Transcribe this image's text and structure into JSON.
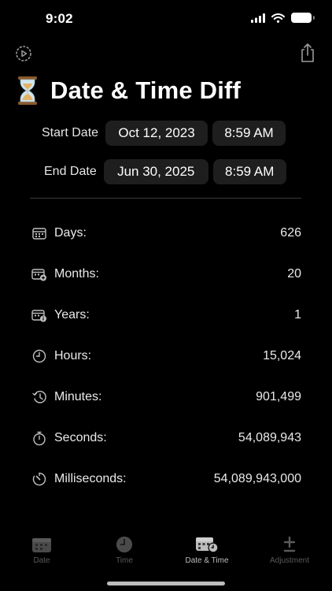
{
  "status_bar": {
    "time": "9:02"
  },
  "header": {
    "title": "Date & Time Diff"
  },
  "start": {
    "label": "Start Date",
    "date": "Oct 12, 2023",
    "time": "8:59 AM"
  },
  "end": {
    "label": "End Date",
    "date": "Jun 30, 2025",
    "time": "8:59 AM"
  },
  "results": [
    {
      "label": "Days:",
      "value": "626",
      "icon": "calendar-icon"
    },
    {
      "label": "Months:",
      "value": "20",
      "icon": "calendar-plus-icon"
    },
    {
      "label": "Years:",
      "value": "1",
      "icon": "calendar-info-icon"
    },
    {
      "label": "Hours:",
      "value": "15,024",
      "icon": "clock-icon"
    },
    {
      "label": "Minutes:",
      "value": "901,499",
      "icon": "history-icon"
    },
    {
      "label": "Seconds:",
      "value": "54,089,943",
      "icon": "stopwatch-icon"
    },
    {
      "label": "Milliseconds:",
      "value": "54,089,943,000",
      "icon": "timer-icon"
    }
  ],
  "tabs": [
    {
      "label": "Date",
      "icon": "calendar-icon",
      "active": false
    },
    {
      "label": "Time",
      "icon": "clock-icon",
      "active": false
    },
    {
      "label": "Date & Time",
      "icon": "calendar-clock-icon",
      "active": true
    },
    {
      "label": "Adjustment",
      "icon": "plus-minus-icon",
      "active": false
    }
  ],
  "colors": {
    "background": "#000000",
    "pill": "#1e1e1e",
    "active_tab": "#bdbdbd",
    "inactive_tab": "#5a5a5a"
  }
}
